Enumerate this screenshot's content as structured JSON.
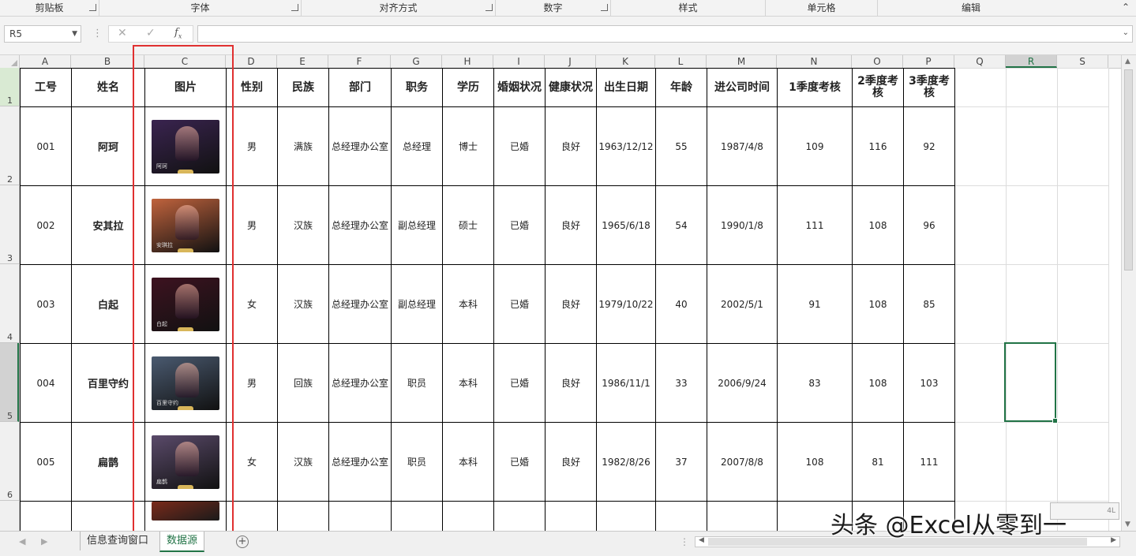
{
  "ribbon": {
    "groups": [
      {
        "label": "剪贴板",
        "launcher": true
      },
      {
        "label": "字体",
        "launcher": true
      },
      {
        "label": "对齐方式",
        "launcher": true
      },
      {
        "label": "数字",
        "launcher": true
      },
      {
        "label": "样式",
        "launcher": false
      },
      {
        "label": "单元格",
        "launcher": false
      },
      {
        "label": "编辑",
        "launcher": false
      }
    ]
  },
  "formula_bar": {
    "name_box": "R5",
    "formula_value": ""
  },
  "columns": [
    "A",
    "B",
    "C",
    "D",
    "E",
    "F",
    "G",
    "H",
    "I",
    "J",
    "K",
    "L",
    "M",
    "N",
    "O",
    "P",
    "Q",
    "R",
    "S"
  ],
  "selected_column": "R",
  "rows": [
    "1",
    "2",
    "3",
    "4",
    "5",
    "6"
  ],
  "selected_row": "5",
  "table": {
    "headers": [
      "工号",
      "姓名",
      "图片",
      "性别",
      "民族",
      "部门",
      "职务",
      "学历",
      "婚姻状况",
      "健康状况",
      "出生日期",
      "年龄",
      "进公司时间",
      "1季度考核",
      "2季度考核",
      "3季度考核"
    ],
    "records": [
      {
        "id": "001",
        "name": "阿珂",
        "pic_caption": "阿珂",
        "gender": "男",
        "ethnicity": "满族",
        "dept": "总经理办公室",
        "title": "总经理",
        "edu": "博士",
        "marital": "已婚",
        "health": "良好",
        "birth": "1963/12/12",
        "age": "55",
        "join": "1987/4/8",
        "q1": "109",
        "q2": "116",
        "q3": "92"
      },
      {
        "id": "002",
        "name": "安其拉",
        "pic_caption": "安琪拉",
        "gender": "男",
        "ethnicity": "汉族",
        "dept": "总经理办公室",
        "title": "副总经理",
        "edu": "硕士",
        "marital": "已婚",
        "health": "良好",
        "birth": "1965/6/18",
        "age": "54",
        "join": "1990/1/8",
        "q1": "111",
        "q2": "108",
        "q3": "96"
      },
      {
        "id": "003",
        "name": "白起",
        "pic_caption": "白起",
        "gender": "女",
        "ethnicity": "汉族",
        "dept": "总经理办公室",
        "title": "副总经理",
        "edu": "本科",
        "marital": "已婚",
        "health": "良好",
        "birth": "1979/10/22",
        "age": "40",
        "join": "2002/5/1",
        "q1": "91",
        "q2": "108",
        "q3": "85"
      },
      {
        "id": "004",
        "name": "百里守约",
        "pic_caption": "百里守约",
        "gender": "男",
        "ethnicity": "回族",
        "dept": "总经理办公室",
        "title": "职员",
        "edu": "本科",
        "marital": "已婚",
        "health": "良好",
        "birth": "1986/11/1",
        "age": "33",
        "join": "2006/9/24",
        "q1": "83",
        "q2": "108",
        "q3": "103"
      },
      {
        "id": "005",
        "name": "扁鹊",
        "pic_caption": "扁鹊",
        "gender": "女",
        "ethnicity": "汉族",
        "dept": "总经理办公室",
        "title": "职员",
        "edu": "本科",
        "marital": "已婚",
        "health": "良好",
        "birth": "1982/8/26",
        "age": "37",
        "join": "2007/8/8",
        "q1": "108",
        "q2": "81",
        "q3": "111"
      }
    ]
  },
  "picture_colors": [
    "#3a2450",
    "#c0633d",
    "#3d1220",
    "#4a5a70",
    "#5a4a6a",
    "#7a2a1a"
  ],
  "sheets": [
    {
      "label": "信息查询窗口",
      "active": false
    },
    {
      "label": "数据源",
      "active": true
    }
  ],
  "watermark": "头条 @Excel从零到一",
  "colors": {
    "accent": "#217346",
    "highlight_box": "#e03030"
  }
}
